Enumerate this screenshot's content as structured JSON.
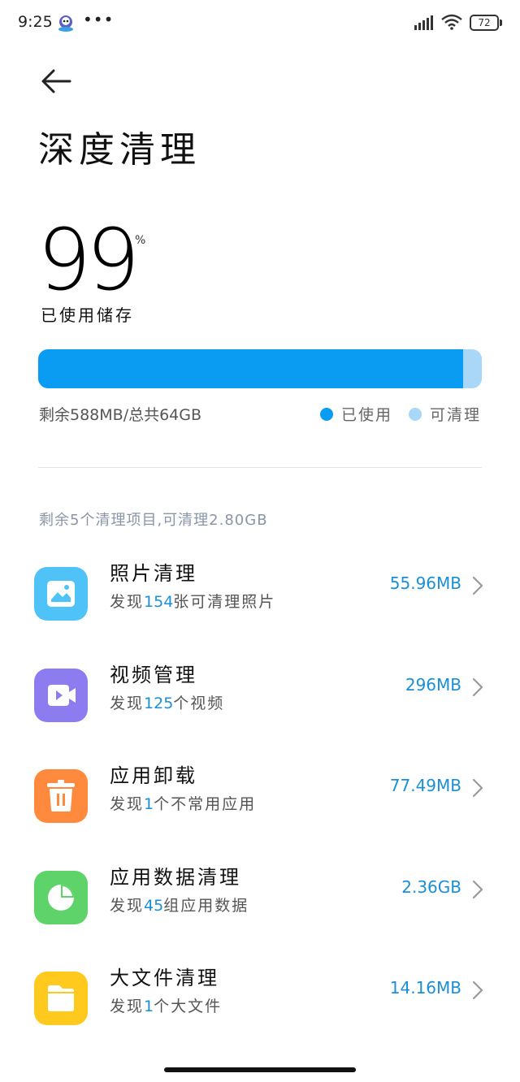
{
  "status_bar": {
    "time": "9:25",
    "dots": "•••",
    "battery": "72"
  },
  "page": {
    "title": "深度清理"
  },
  "usage": {
    "value": "99",
    "unit": "%",
    "label": "已使用储存",
    "used_fraction": 0.957,
    "cleanable_fraction": 0.043,
    "summary": "剩余588MB/总共64GB",
    "legend_used": "已使用",
    "legend_cleanable": "可清理",
    "color_used": "#0a9bf2",
    "color_cleanable": "#a8d7f8"
  },
  "section": {
    "summary": "剩余5个清理项目,可清理2.80GB"
  },
  "items": [
    {
      "title": "照片清理",
      "sub_pre": "发现",
      "sub_num": "154",
      "sub_post": "张可清理照片",
      "size": "55.96MB",
      "icon": "image-icon",
      "color": "#4fc3f7"
    },
    {
      "title": "视频管理",
      "sub_pre": "发现",
      "sub_num": "125",
      "sub_post": "个视频",
      "size": "296MB",
      "icon": "video-icon",
      "color": "#8c7cf0"
    },
    {
      "title": "应用卸载",
      "sub_pre": "发现",
      "sub_num": "1",
      "sub_post": "个不常用应用",
      "size": "77.49MB",
      "icon": "trash-icon",
      "color": "#ff8a3d"
    },
    {
      "title": "应用数据清理",
      "sub_pre": "发现",
      "sub_num": "45",
      "sub_post": "组应用数据",
      "size": "2.36GB",
      "icon": "pie-chart-icon",
      "color": "#5ed36a"
    },
    {
      "title": "大文件清理",
      "sub_pre": "发现",
      "sub_num": "1",
      "sub_post": "个大文件",
      "size": "14.16MB",
      "icon": "folder-icon",
      "color": "#ffc91e"
    }
  ]
}
